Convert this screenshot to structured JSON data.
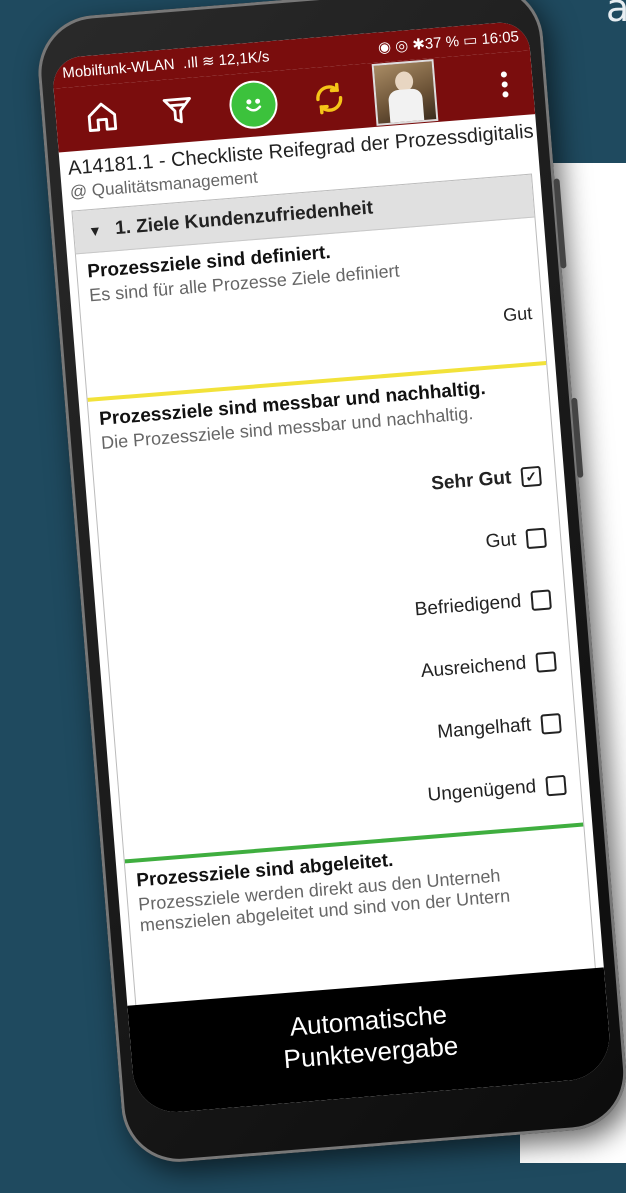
{
  "background": {
    "corner_letter": "a"
  },
  "status_bar": {
    "carrier": "Mobilfunk-WLAN",
    "speed": "12,1K/s",
    "battery": "37 %",
    "time": "16:05"
  },
  "toolbar": {
    "icons": [
      "home-icon",
      "filter-icon",
      "smiley-icon",
      "sync-icon",
      "avatar",
      "more-vert-icon"
    ],
    "accent_color": "#7a0d0d"
  },
  "document": {
    "title": "A14181.1 - Checkliste Reifegrad der Prozessdigitalis",
    "subtitle": "@ Qualitätsmanagement"
  },
  "section": {
    "title": "1. Ziele Kundenzufriedenheit"
  },
  "questions": [
    {
      "title": "Prozessziele sind definiert.",
      "description": "Es sind für alle Prozesse Ziele definiert",
      "answer": "Gut"
    },
    {
      "title": "Prozessziele sind messbar und nachhaltig.",
      "description": "Die Prozessziele sind messbar und nachhaltig.",
      "options": [
        {
          "label": "Sehr Gut",
          "checked": true
        },
        {
          "label": "Gut",
          "checked": false
        },
        {
          "label": "Befriedigend",
          "checked": false
        },
        {
          "label": "Ausreichend",
          "checked": false
        },
        {
          "label": "Mangelhaft",
          "checked": false
        },
        {
          "label": "Ungenügend",
          "checked": false
        }
      ]
    },
    {
      "title": "Prozessziele sind abgeleitet.",
      "description": "Prozessziele werden direkt aus den Unterneh menszielen abgeleitet und sind von der Untern"
    }
  ],
  "footer": {
    "line1": "Automatische",
    "line2": "Punktevergabe"
  }
}
